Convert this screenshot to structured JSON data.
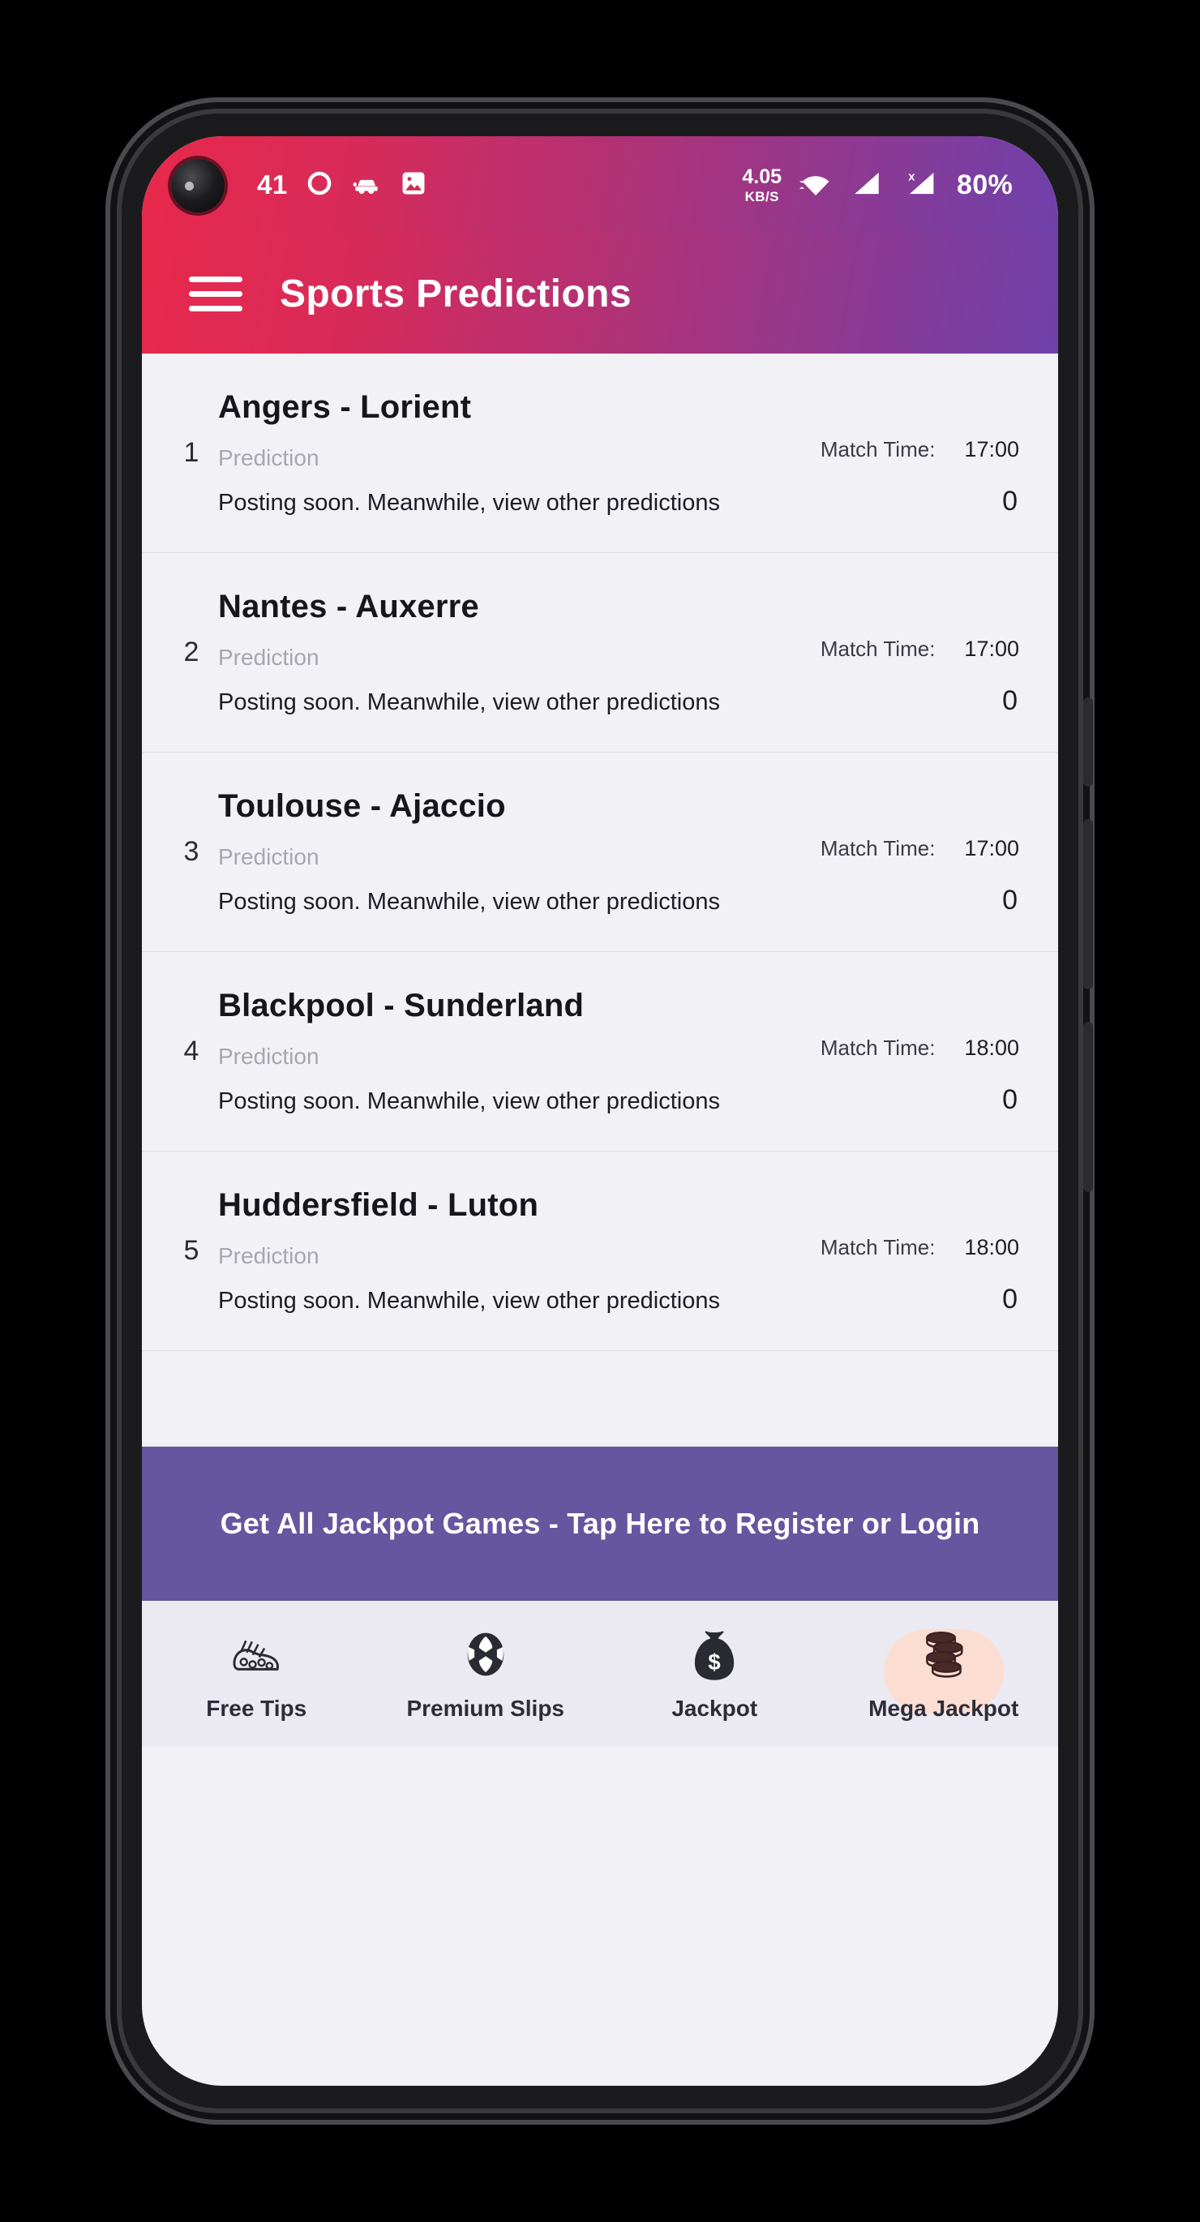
{
  "status_bar": {
    "clock": "41",
    "left_icons": [
      "circle-record-icon",
      "car-icon",
      "image-icon"
    ],
    "data_rate_value": "4.05",
    "data_rate_unit": "KB/S",
    "right_icons": [
      "wifi-icon",
      "signal-bars-icon",
      "signal-no-sim-icon"
    ],
    "battery": "80%",
    "gradient_start": "#e8294b",
    "gradient_end": "#6f41ab"
  },
  "app_bar": {
    "menu_icon": "hamburger-icon",
    "title": "Sports Predictions"
  },
  "list": {
    "headers": {
      "match_time_label": "Match Time:"
    },
    "rows": [
      {
        "index": "1",
        "title": "Angers - Lorient",
        "subtitle": "Prediction",
        "note": "Posting soon. Meanwhile, view other predictions",
        "match_time_label": "Match Time:",
        "match_time": "17:00",
        "odd": "0"
      },
      {
        "index": "2",
        "title": "Nantes - Auxerre",
        "subtitle": "Prediction",
        "note": "Posting soon. Meanwhile, view other predictions",
        "match_time_label": "Match Time:",
        "match_time": "17:00",
        "odd": "0"
      },
      {
        "index": "3",
        "title": "Toulouse - Ajaccio",
        "subtitle": "Prediction",
        "note": "Posting soon. Meanwhile, view other predictions",
        "match_time_label": "Match Time:",
        "match_time": "17:00",
        "odd": "0"
      },
      {
        "index": "4",
        "title": "Blackpool - Sunderland",
        "subtitle": "Prediction",
        "note": "Posting soon. Meanwhile, view other predictions",
        "match_time_label": "Match Time:",
        "match_time": "18:00",
        "odd": "0"
      },
      {
        "index": "5",
        "title": "Huddersfield - Luton",
        "subtitle": "Prediction",
        "note": "Posting soon. Meanwhile, view other predictions",
        "match_time_label": "Match Time:",
        "match_time": "18:00",
        "odd": "0"
      }
    ]
  },
  "cta": {
    "label": "Get All Jackpot Games - Tap Here to Register or Login",
    "background": "#66559f"
  },
  "bottom_nav": {
    "active_index": 3,
    "active_pill_color": "#fcddd2",
    "items": [
      {
        "label": "Free Tips",
        "icon": "football-boot-icon"
      },
      {
        "label": "Premium Slips",
        "icon": "soccer-ball-icon"
      },
      {
        "label": "Jackpot",
        "icon": "money-bag-icon"
      },
      {
        "label": "Mega Jackpot",
        "icon": "coins-stack-icon"
      }
    ]
  }
}
